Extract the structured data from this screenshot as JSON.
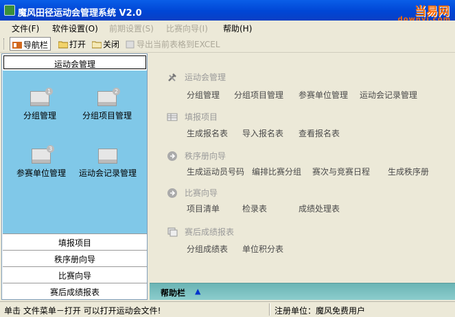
{
  "window": {
    "title": "魔风田径运动会管理系统 V2.0"
  },
  "watermark": {
    "line1": "当易网",
    "line2": "downyi.com"
  },
  "menubar": [
    {
      "label": "文件(F)",
      "enabled": true
    },
    {
      "label": "软件设置(O)",
      "enabled": true
    },
    {
      "label": "前期设置(S)",
      "enabled": false
    },
    {
      "label": "比赛向导(I)",
      "enabled": false
    },
    {
      "label": "帮助(H)",
      "enabled": true
    }
  ],
  "toolbar": {
    "nav": "导航栏",
    "open": "打开",
    "close": "关闭",
    "export": "导出当前表格到EXCEL"
  },
  "sidebar": {
    "header": "运动会管理",
    "items": [
      {
        "label": "分组管理",
        "badge": "1"
      },
      {
        "label": "分组项目管理",
        "badge": "2"
      },
      {
        "label": "参赛单位管理",
        "badge": "3"
      },
      {
        "label": "运动会记录管理",
        "badge": ""
      }
    ],
    "sections": [
      "填报项目",
      "秩序册向导",
      "比赛向导",
      "赛后成绩报表"
    ]
  },
  "main": {
    "sections": [
      {
        "title": "运动会管理",
        "icon": "tools-icon",
        "links": [
          "分组管理",
          "分组项目管理",
          "参赛单位管理",
          "运动会记录管理"
        ]
      },
      {
        "title": "填报项目",
        "icon": "table-icon",
        "links": [
          "生成报名表",
          "导入报名表",
          "查看报名表"
        ]
      },
      {
        "title": "秩序册向导",
        "icon": "arrow-circle-icon",
        "links": [
          "生成运动员号码",
          "编排比赛分组",
          "赛次与竞赛日程",
          "生成秩序册"
        ]
      },
      {
        "title": "比赛向导",
        "icon": "arrow-circle-icon",
        "links": [
          "项目清单",
          "检录表",
          "成绩处理表"
        ]
      },
      {
        "title": "赛后成绩报表",
        "icon": "report-icon",
        "links": [
          "分组成绩表",
          "单位积分表"
        ]
      }
    ]
  },
  "helpbar": {
    "label": "帮助栏",
    "arrow": "▲"
  },
  "statusbar": {
    "message": "单击 文件菜单－打开 可以打开运动会文件!",
    "registration": "注册单位：魔风免费用户"
  }
}
